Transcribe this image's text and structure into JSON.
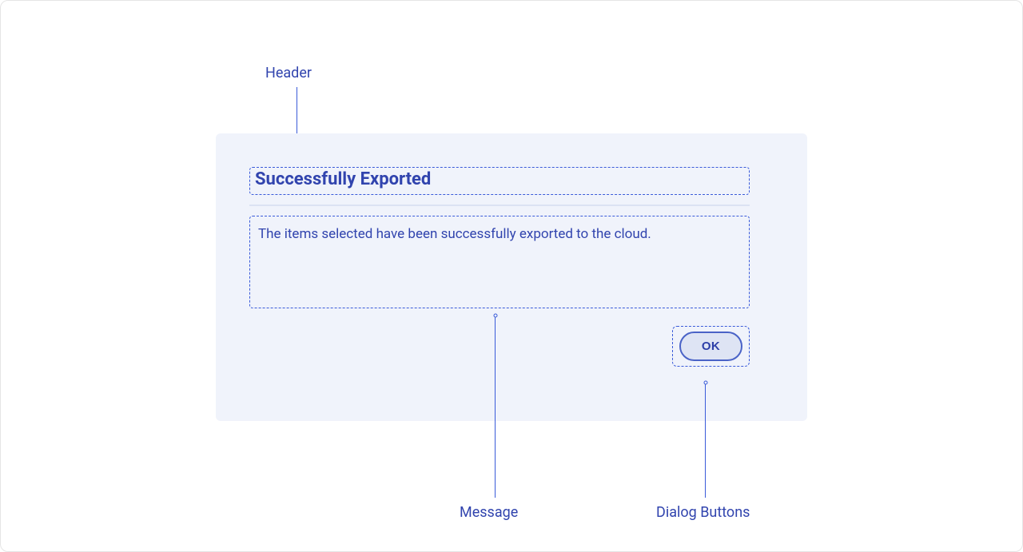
{
  "labels": {
    "header": "Header",
    "message": "Message",
    "buttons": "Dialog Buttons"
  },
  "dialog": {
    "header": "Successfully Exported",
    "message": "The items selected have been successfully exported to the cloud.",
    "ok_label": "OK"
  }
}
